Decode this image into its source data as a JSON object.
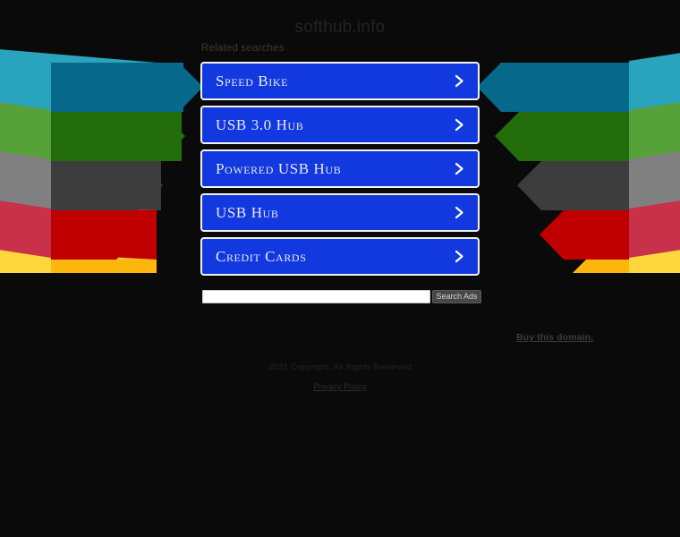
{
  "page": {
    "title": "softhub.info",
    "background_color": "#0a0a0a"
  },
  "related": {
    "label": "Related searches",
    "accent_color": "#1238e0",
    "items": [
      {
        "label": "Speed Bike",
        "icon": "chevron-right-icon"
      },
      {
        "label": "USB 3.0 Hub",
        "icon": "chevron-right-icon"
      },
      {
        "label": "Powered USB Hub",
        "icon": "chevron-right-icon"
      },
      {
        "label": "USB Hub",
        "icon": "chevron-right-icon"
      },
      {
        "label": "Credit Cards",
        "icon": "chevron-right-icon"
      }
    ]
  },
  "search": {
    "value": "",
    "placeholder": "",
    "button_label": "Search Ads",
    "button_color": "#474747"
  },
  "footer": {
    "buy_domain_label": "Buy this domain.",
    "copyright": "2021 Copyright. All Rights Reserved",
    "privacy_policy_label": "Privacy Policy"
  },
  "decoration": {
    "name": "chevron-bands",
    "bands": [
      {
        "name": "teal",
        "main": "#076a8c",
        "light": "#2aa3bd"
      },
      {
        "name": "green",
        "main": "#226c0c",
        "light": "#57a13b"
      },
      {
        "name": "gray",
        "main": "#3d3d3d",
        "light": "#808080"
      },
      {
        "name": "red",
        "main": "#c00000",
        "light": "#c9304a"
      },
      {
        "name": "yellow",
        "main": "#fdb60c",
        "light": "#fcd63a"
      }
    ]
  }
}
